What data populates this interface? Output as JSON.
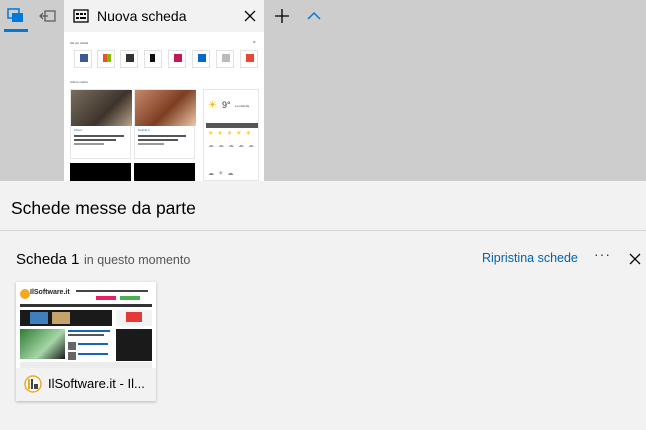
{
  "tab_strip": {
    "active_tab": {
      "title": "Nuova scheda"
    },
    "preview": {
      "top_sites_header": "Siti più visitati",
      "news_header": "Ultime notizie",
      "news": [
        {
          "source": "Libero",
          "headline": "Mobile smartphone pubblico nelle notizie"
        },
        {
          "source": "Notizie.it",
          "headline": "Belle foto! Coffe Rai Oscar"
        }
      ],
      "weather": {
        "temp": "9°",
        "city": "Lombardia"
      }
    }
  },
  "panel": {
    "title": "Schede messe da parte",
    "group": {
      "name": "Scheda 1",
      "time": "in questo momento",
      "restore_label": "Ripristina schede",
      "more_label": "···"
    },
    "saved_tabs": [
      {
        "title": "IlSoftware.it - Il...",
        "site_name": "IlSoftware.it",
        "favicon_text": "ILS"
      }
    ]
  },
  "colors": {
    "accent": "#0078d7",
    "link": "#0063b1",
    "tabstrip_bg": "#cdcdcd",
    "panel_bg": "#f2f2f2"
  },
  "icons": {
    "tabs_aside_button": "tabs-aside-icon",
    "set_aside_button": "set-aside-icon",
    "tab_icon": "new-tab-page-icon",
    "close": "close-icon",
    "add": "plus-icon",
    "collapse": "chevron-up-icon"
  }
}
